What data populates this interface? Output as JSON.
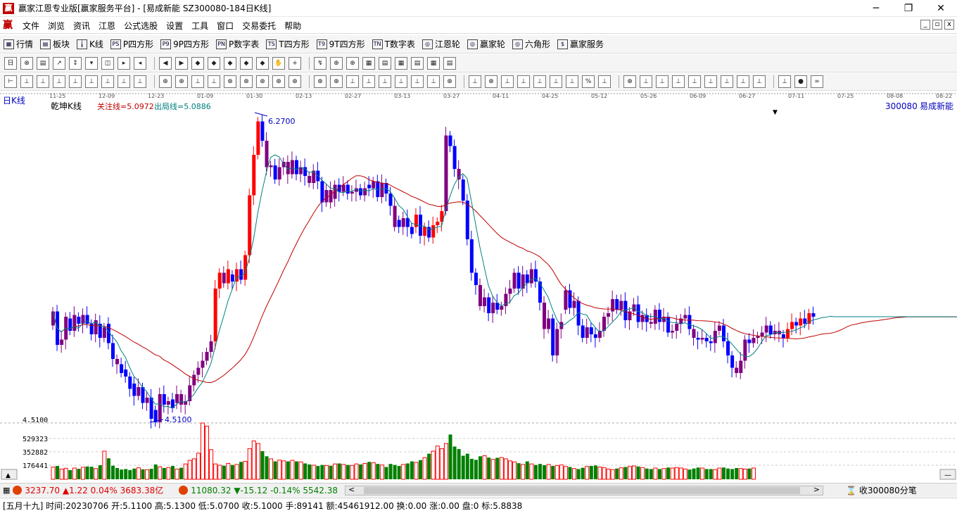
{
  "window": {
    "title": "赢家江恩专业版[赢家服务平台] - [易成新能  SZ300080-184日K线]",
    "logo": "赢",
    "controls": [
      "─",
      "❐",
      "✕"
    ]
  },
  "menu": {
    "logo": "赢",
    "items": [
      "文件",
      "浏览",
      "资讯",
      "江恩",
      "公式选股",
      "设置",
      "工具",
      "窗口",
      "交易委托",
      "帮助"
    ],
    "mdi": [
      "_",
      "▫",
      "x"
    ]
  },
  "toolbar1": [
    {
      "icon": "grid-icon",
      "glyph": "▦",
      "label": "行情"
    },
    {
      "icon": "blocks-icon",
      "glyph": "▤",
      "label": "板块"
    },
    {
      "icon": "kline-icon",
      "glyph": "╽",
      "label": "K线"
    },
    {
      "icon": "p-square-icon",
      "glyph": "PS",
      "label": "P四方形"
    },
    {
      "icon": "p9-square-icon",
      "glyph": "P9",
      "label": "9P四方形"
    },
    {
      "icon": "pn-icon",
      "glyph": "PN",
      "label": "P数字表"
    },
    {
      "icon": "ts-icon",
      "glyph": "TS",
      "label": "T四方形"
    },
    {
      "icon": "t9-icon",
      "glyph": "T9",
      "label": "9T四方形"
    },
    {
      "icon": "tn-icon",
      "glyph": "TN",
      "label": "T数字表"
    },
    {
      "icon": "gann-wheel-icon",
      "glyph": "◎",
      "label": "江恩轮"
    },
    {
      "icon": "winner-wheel-icon",
      "glyph": "◎",
      "label": "赢家轮"
    },
    {
      "icon": "hexagon-icon",
      "glyph": "◎",
      "label": "六角形"
    },
    {
      "icon": "dollar-icon",
      "glyph": "$",
      "label": "赢家服务"
    }
  ],
  "toolbar2": [
    "日",
    "⊗",
    "▤",
    "↗",
    "↕",
    "▾",
    "◫",
    "▸",
    "◂",
    "◀",
    "▶",
    "◆",
    "◆",
    "◆",
    "◆",
    "◆",
    "✋",
    "+",
    "↯",
    "⊕",
    "⊕",
    "▦",
    "▤",
    "▦",
    "▤",
    "▦",
    "▤"
  ],
  "toolbar3": [
    "⊢",
    "⊥",
    "⊥",
    "⊥",
    "⊥",
    "⊥",
    "⊥",
    "⊥",
    "⊥",
    "⊕",
    "⊕",
    "⊥",
    "⊥",
    "⊕",
    "⊕",
    "⊕",
    "⊕",
    "⊕",
    "⊕",
    "⊕",
    "⊥",
    "⊥",
    "⊥",
    "⊥",
    "⊥",
    "⊥",
    "⊕",
    "⊥",
    "⊕",
    "⊥",
    "⊥",
    "⊥",
    "⊥",
    "⊥",
    "%",
    "⊥",
    "⊕",
    "⊥",
    "⊥",
    "⊥",
    "⊥",
    "⊥",
    "⊥",
    "⊥",
    "⊥",
    "⊥",
    "●",
    "∞"
  ],
  "chart": {
    "period_label": "日K线",
    "indicator_name": "乾坤K线",
    "focus_line_label": "关注线=5.0972",
    "exit_line_label": "出局线=5.0886",
    "stock_code": "300080",
    "stock_name": "易成新能",
    "high_label": "6.2700",
    "low_label": "4.5100",
    "volume_scale": [
      "4.5100",
      "529323",
      "352882",
      "176441"
    ],
    "dates": [
      "11-25",
      "12-09",
      "12-23",
      "01-09",
      "01-30",
      "02-13",
      "02-27",
      "03-13",
      "03-27",
      "04-11",
      "04-25",
      "05-12",
      "05-26",
      "06-09",
      "06-27",
      "07-11",
      "07-25",
      "08-08",
      "08-22"
    ],
    "colors": {
      "up": "#ff0000",
      "down": "#0000ff",
      "purple": "#800080",
      "slow_ma": "#c00000",
      "fast_ma": "#008080",
      "vol_up": "#ff0000",
      "vol_down": "#008000"
    }
  },
  "chart_data": {
    "type": "candlestick",
    "title": "乾坤K线",
    "ylim": [
      4.51,
      6.27
    ],
    "points": [
      [
        5.06,
        5.14
      ],
      [
        5.14,
        4.95
      ],
      [
        4.95,
        4.98
      ],
      [
        4.98,
        5.11
      ],
      [
        5.1,
        5.03
      ],
      [
        5.03,
        5.12
      ],
      [
        5.11,
        5.07
      ],
      [
        5.07,
        5.12
      ],
      [
        5.12,
        5.07
      ],
      [
        5.07,
        5.01
      ],
      [
        5.01,
        5.09
      ],
      [
        5.07,
        4.99
      ],
      [
        4.99,
        5.05
      ],
      [
        5.07,
        4.96
      ],
      [
        4.96,
        4.87
      ],
      [
        4.87,
        4.84
      ],
      [
        4.84,
        4.79
      ],
      [
        4.81,
        4.77
      ],
      [
        4.77,
        4.7
      ],
      [
        4.73,
        4.66
      ],
      [
        4.66,
        4.71
      ],
      [
        4.71,
        4.62
      ],
      [
        4.62,
        4.65
      ],
      [
        4.65,
        4.53
      ],
      [
        4.58,
        4.51
      ],
      [
        4.51,
        4.67
      ],
      [
        4.67,
        4.61
      ],
      [
        4.61,
        4.63
      ],
      [
        4.64,
        4.59
      ],
      [
        4.62,
        4.67
      ],
      [
        4.67,
        4.61
      ],
      [
        4.61,
        4.63
      ],
      [
        4.63,
        4.72
      ],
      [
        4.72,
        4.78
      ],
      [
        4.78,
        4.82
      ],
      [
        4.82,
        4.86
      ],
      [
        4.86,
        4.91
      ],
      [
        4.91,
        4.97
      ],
      [
        4.97,
        5.27
      ],
      [
        5.27,
        5.36
      ],
      [
        5.36,
        5.3
      ],
      [
        5.3,
        5.38
      ],
      [
        5.35,
        5.31
      ],
      [
        5.31,
        5.38
      ],
      [
        5.38,
        5.32
      ],
      [
        5.32,
        5.46
      ],
      [
        5.46,
        5.8
      ],
      [
        5.8,
        6.03
      ],
      [
        6.03,
        6.22
      ],
      [
        6.22,
        6.11
      ],
      [
        6.11,
        5.96
      ],
      [
        5.96,
        5.97
      ],
      [
        5.97,
        5.89
      ],
      [
        5.89,
        5.96
      ],
      [
        5.96,
        5.99
      ],
      [
        5.99,
        5.92
      ],
      [
        5.92,
        6.0
      ],
      [
        6.0,
        5.92
      ],
      [
        5.92,
        5.96
      ],
      [
        5.96,
        5.91
      ],
      [
        5.91,
        5.87
      ],
      [
        5.87,
        5.94
      ],
      [
        5.94,
        5.88
      ],
      [
        5.88,
        5.76
      ],
      [
        5.76,
        5.83
      ],
      [
        5.83,
        5.76
      ],
      [
        5.78,
        5.86
      ],
      [
        5.86,
        5.82
      ],
      [
        5.82,
        5.86
      ],
      [
        5.86,
        5.81
      ],
      [
        5.81,
        5.82
      ],
      [
        5.82,
        5.84
      ],
      [
        5.84,
        5.8
      ],
      [
        5.8,
        5.84
      ],
      [
        5.86,
        5.84
      ],
      [
        5.84,
        5.88
      ],
      [
        5.88,
        5.79
      ],
      [
        5.79,
        5.87
      ],
      [
        5.87,
        5.81
      ],
      [
        5.81,
        5.74
      ],
      [
        5.74,
        5.62
      ],
      [
        5.66,
        5.62
      ],
      [
        5.62,
        5.67
      ],
      [
        5.67,
        5.62
      ],
      [
        5.62,
        5.58
      ],
      [
        5.62,
        5.69
      ],
      [
        5.69,
        5.57
      ],
      [
        5.57,
        5.62
      ],
      [
        5.62,
        5.56
      ],
      [
        5.56,
        5.63
      ],
      [
        5.63,
        5.65
      ],
      [
        5.65,
        5.71
      ],
      [
        5.71,
        6.14
      ],
      [
        6.14,
        6.08
      ],
      [
        6.08,
        5.95
      ],
      [
        5.95,
        5.89
      ],
      [
        5.89,
        5.77
      ],
      [
        5.77,
        5.55
      ],
      [
        5.55,
        5.36
      ],
      [
        5.36,
        5.29
      ],
      [
        5.29,
        5.17
      ],
      [
        5.17,
        5.22
      ],
      [
        5.22,
        5.13
      ],
      [
        5.13,
        5.19
      ],
      [
        5.19,
        5.15
      ],
      [
        5.15,
        5.17
      ],
      [
        5.17,
        5.24
      ],
      [
        5.24,
        5.27
      ],
      [
        5.27,
        5.36
      ],
      [
        5.36,
        5.27
      ],
      [
        5.27,
        5.35
      ],
      [
        5.35,
        5.3
      ],
      [
        5.3,
        5.38
      ],
      [
        5.38,
        5.31
      ],
      [
        5.31,
        5.19
      ],
      [
        5.19,
        5.04
      ],
      [
        5.04,
        5.1
      ],
      [
        5.1,
        4.89
      ],
      [
        4.89,
        5.04
      ],
      [
        5.04,
        5.08
      ],
      [
        5.15,
        5.26
      ],
      [
        5.26,
        5.16
      ],
      [
        5.16,
        5.2
      ],
      [
        5.2,
        5.06
      ],
      [
        5.06,
        4.99
      ],
      [
        4.99,
        5.05
      ],
      [
        5.05,
        5.01
      ],
      [
        5.01,
        4.99
      ],
      [
        4.99,
        5.03
      ],
      [
        5.03,
        5.11
      ],
      [
        5.11,
        5.13
      ],
      [
        5.14,
        5.21
      ],
      [
        5.21,
        5.15
      ],
      [
        5.15,
        5.2
      ],
      [
        5.2,
        5.09
      ],
      [
        5.09,
        5.14
      ],
      [
        5.14,
        5.18
      ],
      [
        5.18,
        5.08
      ],
      [
        5.08,
        5.12
      ],
      [
        5.12,
        5.08
      ],
      [
        5.08,
        5.07
      ],
      [
        5.07,
        5.15
      ],
      [
        5.15,
        5.08
      ],
      [
        5.08,
        5.11
      ],
      [
        5.11,
        5.02
      ],
      [
        5.02,
        5.03
      ],
      [
        5.03,
        5.07
      ],
      [
        5.07,
        5.1
      ],
      [
        5.1,
        5.12
      ],
      [
        5.12,
        5.04
      ],
      [
        5.04,
        4.99
      ],
      [
        4.99,
        4.98
      ],
      [
        4.98,
        4.99
      ],
      [
        4.99,
        4.97
      ],
      [
        4.97,
        4.96
      ],
      [
        4.96,
        5.03
      ],
      [
        5.03,
        5.06
      ],
      [
        5.06,
        4.97
      ],
      [
        4.97,
        4.89
      ],
      [
        4.89,
        4.82
      ],
      [
        4.82,
        4.79
      ],
      [
        4.79,
        4.86
      ],
      [
        4.86,
        4.98
      ],
      [
        4.98,
        4.96
      ],
      [
        4.96,
        4.99
      ],
      [
        4.99,
        5.0
      ],
      [
        5.0,
        5.02
      ],
      [
        5.02,
        5.06
      ],
      [
        5.06,
        5.01
      ],
      [
        5.01,
        5.03
      ],
      [
        5.03,
        5.01
      ],
      [
        5.01,
        4.99
      ],
      [
        4.99,
        5.04
      ],
      [
        5.04,
        5.08
      ],
      [
        5.08,
        5.06
      ],
      [
        5.06,
        5.1
      ],
      [
        5.1,
        5.07
      ],
      [
        5.07,
        5.13
      ],
      [
        5.13,
        5.11
      ]
    ],
    "volume": [
      48,
      52,
      40,
      43,
      36,
      44,
      41,
      47,
      50,
      49,
      42,
      55,
      110,
      82,
      53,
      44,
      38,
      40,
      36,
      42,
      45,
      39,
      37,
      41,
      58,
      49,
      44,
      46,
      52,
      40,
      45,
      60,
      74,
      80,
      102,
      220,
      208,
      116,
      60,
      55,
      53,
      62,
      56,
      58,
      68,
      70,
      120,
      150,
      140,
      110,
      90,
      80,
      70,
      75,
      72,
      70,
      74,
      70,
      68,
      62,
      58,
      55,
      52,
      56,
      54,
      53,
      60,
      62,
      58,
      56,
      54,
      60,
      58,
      62,
      68,
      65,
      60,
      56,
      48,
      60,
      56,
      52,
      58,
      62,
      70,
      66,
      75,
      85,
      100,
      110,
      130,
      120,
      140,
      175,
      128,
      118,
      92,
      100,
      80,
      76,
      90,
      92,
      85,
      78,
      84,
      85,
      80,
      72,
      68,
      63,
      58,
      70,
      60,
      56,
      60,
      55,
      58,
      52,
      54,
      56,
      50,
      48,
      42,
      40,
      45,
      50,
      52,
      54,
      48,
      46,
      40,
      38,
      42,
      45,
      48,
      50,
      52,
      50,
      46,
      42,
      40,
      44,
      40,
      42,
      46,
      44,
      46,
      44,
      40,
      38,
      42,
      46,
      44,
      40,
      40,
      38,
      44,
      46,
      42,
      40,
      44,
      42,
      40,
      42,
      44
    ],
    "volume_max": 529323
  },
  "status": {
    "sh_index": "3237.70",
    "sh_change": "▲1.22",
    "sh_pct": "0.04%",
    "sh_amount": "3683.38亿",
    "sz_index": "11080.32",
    "sz_change": "▼-15.12",
    "sz_pct": "-0.14%",
    "sz_amount": "5542.38",
    "receive_label": "收300080分笔"
  },
  "info": {
    "text": "[五月十九] 时间:20230706 开:5.1100 高:5.1300 低:5.0700 收:5.1000 手:89141 额:45461912.00 换:0.00 涨:0.00 盘:0 标:5.8838"
  }
}
